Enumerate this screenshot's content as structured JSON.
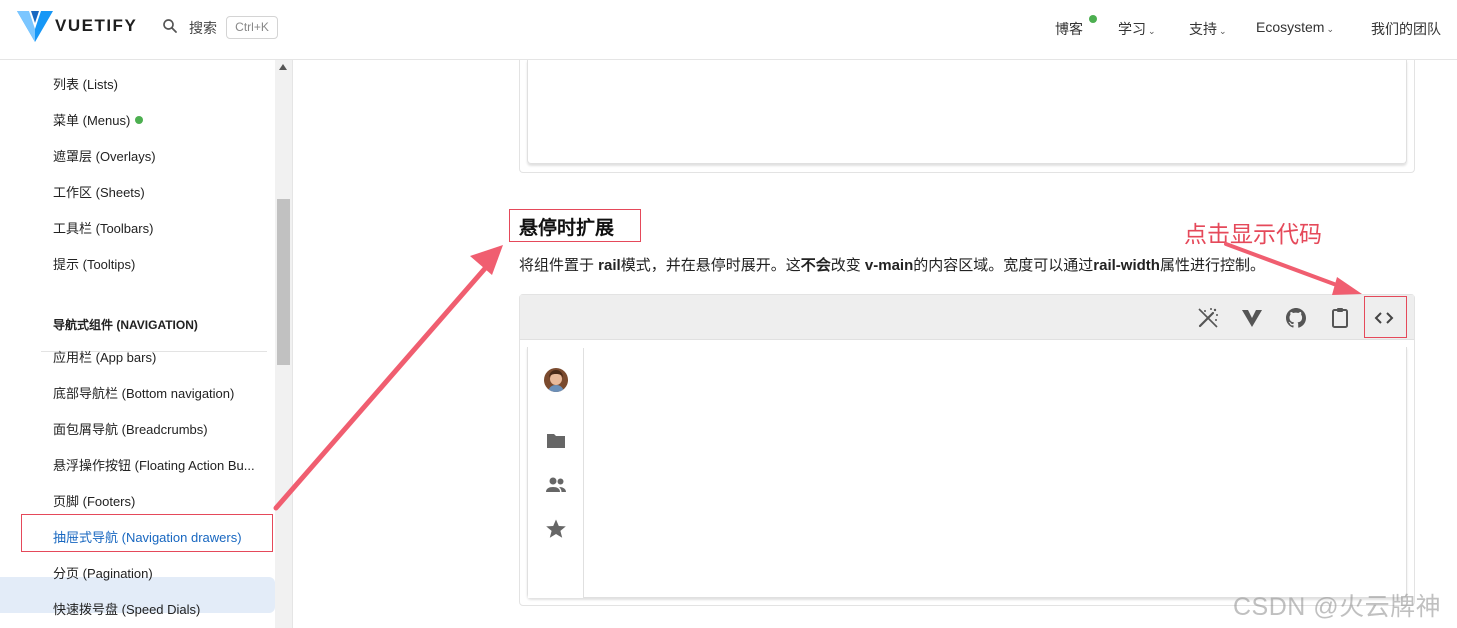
{
  "header": {
    "logo_text": "VUETIFY",
    "search_label": "搜索",
    "search_shortcut": "Ctrl+K",
    "nav": {
      "blog": "博客",
      "learn": "学习",
      "support": "支持",
      "ecosystem": "Ecosystem",
      "team": "我们的团队"
    },
    "chevron": "⌄"
  },
  "sidebar": {
    "items_top": [
      "列表 (Lists)",
      "菜单 (Menus)",
      "遮罩层 (Overlays)",
      "工作区 (Sheets)",
      "工具栏 (Toolbars)",
      "提示 (Tooltips)"
    ],
    "section_title": "导航式组件 (NAVIGATION)",
    "items_nav": [
      "应用栏 (App bars)",
      "底部导航栏 (Bottom navigation)",
      "面包屑导航 (Breadcrumbs)",
      "悬浮操作按钮 (Floating Action Bu...",
      "页脚 (Footers)",
      "抽屉式导航 (Navigation drawers)",
      "分页 (Pagination)",
      "快速拨号盘 (Speed Dials)"
    ],
    "active_item": "抽屉式导航 (Navigation drawers)"
  },
  "main": {
    "heading": "悬停时扩展",
    "description": {
      "p1": "将组件置于 ",
      "b1": "rail",
      "p2": "模式，并在悬停时展开。这",
      "b2": "不会",
      "p3": "改变 ",
      "b3": "v-main",
      "p4": "的内容区域。宽度可以通过",
      "b4": "rail-width",
      "p5": "属性进行控制。"
    },
    "annotation": "点击显示代码",
    "toolbar_icons": [
      "theme-toggle-icon",
      "vuetify-playground-icon",
      "github-icon",
      "clipboard-icon",
      "code-icon"
    ],
    "rail_icons": [
      "avatar",
      "folder-icon",
      "people-icon",
      "star-icon"
    ]
  },
  "watermark": "CSDN @火云牌神",
  "colors": {
    "accent": "#1867c0",
    "annotation": "#e5495a",
    "status_dot": "#4caf50"
  }
}
